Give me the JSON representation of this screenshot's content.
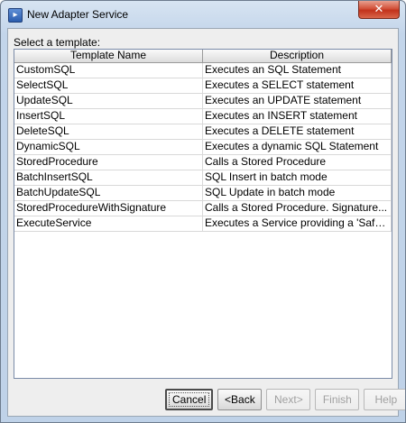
{
  "window": {
    "title": "New Adapter Service",
    "close_glyph": "✕"
  },
  "dialog": {
    "prompt": "Select a template:",
    "columns": [
      "Template Name",
      "Description"
    ],
    "rows": [
      {
        "name": "CustomSQL",
        "description": "Executes an SQL Statement"
      },
      {
        "name": "SelectSQL",
        "description": "Executes a SELECT statement"
      },
      {
        "name": "UpdateSQL",
        "description": "Executes an UPDATE statement"
      },
      {
        "name": "InsertSQL",
        "description": "Executes an INSERT statement"
      },
      {
        "name": "DeleteSQL",
        "description": "Executes a DELETE statement"
      },
      {
        "name": "DynamicSQL",
        "description": "Executes a dynamic SQL Statement"
      },
      {
        "name": "StoredProcedure",
        "description": "Calls a Stored Procedure"
      },
      {
        "name": "BatchInsertSQL",
        "description": "SQL Insert in batch mode"
      },
      {
        "name": "BatchUpdateSQL",
        "description": "SQL Update in batch mode"
      },
      {
        "name": "StoredProcedureWithSignature",
        "description": "Calls a Stored Procedure. Signature..."
      },
      {
        "name": "ExecuteService",
        "description": "Executes a Service providing a 'Safe'..."
      }
    ]
  },
  "buttons": {
    "cancel": "Cancel",
    "back": "<Back",
    "next": "Next>",
    "finish": "Finish",
    "help": "Help"
  },
  "colors": {
    "title_gradient_top": "#d7e4f2",
    "close_button": "#c2321b",
    "table_border": "#7a8ba8"
  }
}
